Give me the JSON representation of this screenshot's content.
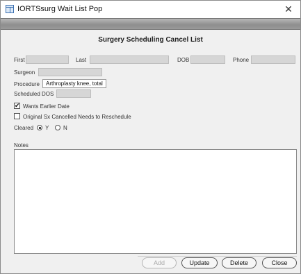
{
  "window": {
    "title": "IORTSsurg Wait List Pop",
    "close_glyph": "✕"
  },
  "header": {
    "title": "Surgery Scheduling  Cancel List"
  },
  "fields": {
    "first_label": "First",
    "last_label": "Last",
    "dob_label": "DOB",
    "phone_label": "Phone",
    "surgeon_label": "Surgeon",
    "procedure_label": "Procedure",
    "procedure_value": "Arthroplasty knee, total",
    "scheduled_dos_label": "Scheduled DOS"
  },
  "options": {
    "wants_earlier_date": {
      "label": "Wants Earlier Date",
      "checked": true
    },
    "original_cancelled": {
      "label": "Original Sx Cancelled Needs to Reschedule",
      "checked": false
    },
    "cleared_label": "Cleared",
    "cleared_yes": "Y",
    "cleared_no": "N",
    "cleared_selected": "Y"
  },
  "notes": {
    "label": "Notes",
    "value": ""
  },
  "buttons": {
    "add": "Add",
    "update": "Update",
    "delete": "Delete",
    "close": "Close"
  },
  "colors": {
    "band": "#9a9a9a",
    "field_fill": "#d6d6d6",
    "window_bg": "#f0f0f0"
  }
}
